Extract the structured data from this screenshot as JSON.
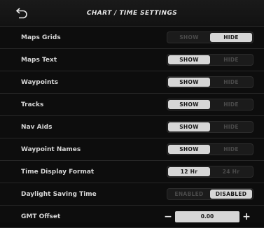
{
  "header": {
    "title": "CHART / TIME SETTINGS",
    "back_icon": "back-arrow-icon"
  },
  "settings": [
    {
      "label": "Maps Grids",
      "options": [
        "SHOW",
        "HIDE"
      ],
      "selected": 1
    },
    {
      "label": "Maps Text",
      "options": [
        "SHOW",
        "HIDE"
      ],
      "selected": 0
    },
    {
      "label": "Waypoints",
      "options": [
        "SHOW",
        "HIDE"
      ],
      "selected": 0
    },
    {
      "label": "Tracks",
      "options": [
        "SHOW",
        "HIDE"
      ],
      "selected": 0
    },
    {
      "label": "Nav Aids",
      "options": [
        "SHOW",
        "HIDE"
      ],
      "selected": 0
    },
    {
      "label": "Waypoint Names",
      "options": [
        "SHOW",
        "HIDE"
      ],
      "selected": 0
    },
    {
      "label": "Time Display Format",
      "options": [
        "12 Hr",
        "24 Hr"
      ],
      "selected": 0
    },
    {
      "label": "Daylight Saving Time",
      "options": [
        "ENABLED",
        "DISABLED"
      ],
      "selected": 1
    }
  ],
  "gmt": {
    "label": "GMT Offset",
    "value": "0.00",
    "minus": "−",
    "plus": "+"
  },
  "colors": {
    "selected_bg": "#d6d6d6",
    "unselected_text": "#4a4a4a",
    "background": "#0d0d0d"
  }
}
